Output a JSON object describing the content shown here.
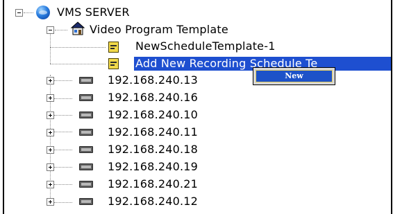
{
  "tree": {
    "root": {
      "label": "VMS SERVER",
      "icon": "globe-icon",
      "expanded": true
    },
    "template_group": {
      "label": "Video Program Template",
      "icon": "house-icon",
      "expanded": true,
      "children": [
        {
          "label": "NewScheduleTemplate-1",
          "icon": "template-doc-icon"
        },
        {
          "label": "Add New Recording Schedule Te",
          "icon": "template-doc-icon",
          "selected": true
        }
      ]
    },
    "devices": [
      {
        "label": "192.168.240.13",
        "icon": "device-icon"
      },
      {
        "label": "192.168.240.16",
        "icon": "device-icon"
      },
      {
        "label": "192.168.240.10",
        "icon": "device-icon"
      },
      {
        "label": "192.168.240.11",
        "icon": "device-icon"
      },
      {
        "label": "192.168.240.18",
        "icon": "device-icon"
      },
      {
        "label": "192.168.240.19",
        "icon": "device-icon"
      },
      {
        "label": "192.168.240.21",
        "icon": "device-icon"
      },
      {
        "label": "192.168.240.12",
        "icon": "device-icon"
      }
    ]
  },
  "context_menu": {
    "items": [
      {
        "label": "New"
      }
    ]
  },
  "colors": {
    "selection": "#1e4fd0",
    "menu_highlight": "#1d52c8",
    "menu_border": "#e8d060",
    "template_icon": "#f1d94a"
  }
}
